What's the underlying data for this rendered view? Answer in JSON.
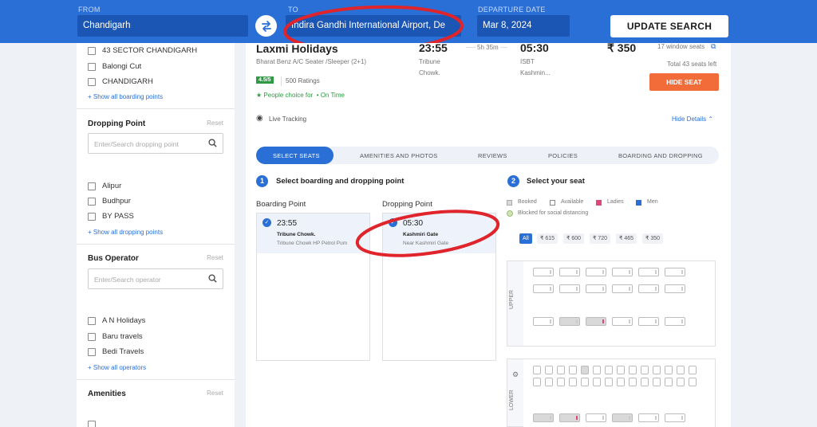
{
  "header": {
    "from_label": "FROM",
    "from_value": "Chandigarh",
    "to_label": "TO",
    "to_value": "Indira Gandhi International Airport, De",
    "date_label": "DEPARTURE DATE",
    "date_value": "Mar 8, 2024",
    "update_button": "UPDATE SEARCH",
    "accent": "#2a6fd6"
  },
  "sidebar": {
    "boarding_items": [
      "43 SECTOR CHANDIGARH",
      "Balongi Cut",
      "CHANDIGARH"
    ],
    "boarding_link": "+ Show all boarding points",
    "dropping": {
      "title": "Dropping Point",
      "reset": "Reset",
      "placeholder": "Enter/Search dropping point",
      "items": [
        "Alipur",
        "Budhpur",
        "BY PASS"
      ],
      "link": "+ Show all dropping points"
    },
    "operator": {
      "title": "Bus Operator",
      "reset": "Reset",
      "placeholder": "Enter/Search operator",
      "items": [
        "A N Holidays",
        "Baru travels",
        "Bedi Travels"
      ],
      "link": "+ Show all operators"
    },
    "amenities": {
      "title": "Amenities",
      "reset": "Reset"
    }
  },
  "bus": {
    "name": "Laxmi Holidays",
    "type": "Bharat Benz A/C Seater /Sleeper (2+1)",
    "rating": "4.5/5",
    "ratings_count": "500 Ratings",
    "people_choice": "People choice for",
    "on_time": "• On Time",
    "dep_time": "23:55",
    "dep_place_1": "Tribune",
    "dep_place_2": "Chowk.",
    "duration": "5h 35m",
    "arr_time": "05:30",
    "arr_place_1": "ISBT",
    "arr_place_2": "Kashmin...",
    "price": "₹ 350",
    "window_seats": "17 window seats",
    "total_seats": "Total 43 seats left",
    "hide_seat": "HIDE SEAT",
    "live_tracking": "Live Tracking",
    "hide_details": "Hide Details"
  },
  "tabs": [
    "SELECT SEATS",
    "AMENITIES AND PHOTOS",
    "REVIEWS",
    "POLICIES",
    "BOARDING AND DROPPING"
  ],
  "step1": {
    "num": "1",
    "title": "Select boarding and dropping point",
    "boarding_label": "Boarding Point",
    "boarding_time": "23:55",
    "boarding_name": "Tribune Chowk.",
    "boarding_addr": "Tribune Chowk HP Petrol Pum",
    "dropping_label": "Dropping Point",
    "dropping_time": "05:30",
    "dropping_name": "Kashmiri Gate",
    "dropping_addr": "Near Kashmiri Gate"
  },
  "step2": {
    "num": "2",
    "title": "Select your seat",
    "legend": {
      "booked": "Booked",
      "available": "Available",
      "ladies": "Ladies",
      "men": "Men",
      "distancing": "Blocked for social distancing"
    },
    "filters": [
      "All",
      "₹ 615",
      "₹ 600",
      "₹ 720",
      "₹ 465",
      "₹ 350"
    ],
    "upper": "UPPER",
    "lower": "LOWER"
  }
}
